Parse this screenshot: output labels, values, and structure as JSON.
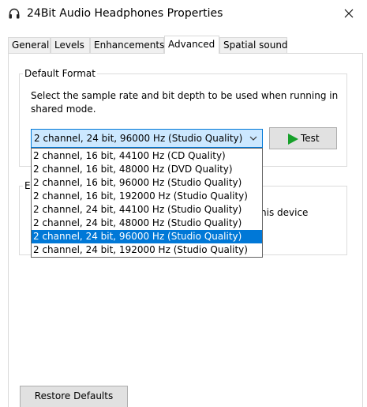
{
  "window": {
    "title": "24Bit Audio Headphones Properties",
    "app_icon": "headphones-icon",
    "close_icon": "close-icon"
  },
  "tabs": [
    {
      "label": "General"
    },
    {
      "label": "Levels"
    },
    {
      "label": "Enhancements"
    },
    {
      "label": "Advanced",
      "active": true
    },
    {
      "label": "Spatial sound"
    }
  ],
  "default_format": {
    "label": "Default Format",
    "description": "Select the sample rate and bit depth to be used when running in shared mode.",
    "selected_value": "2 channel, 24 bit, 96000 Hz (Studio Quality)",
    "test_label": "Test",
    "options": [
      "2 channel, 16 bit, 44100 Hz (CD Quality)",
      "2 channel, 16 bit, 48000 Hz (DVD Quality)",
      "2 channel, 16 bit, 96000 Hz (Studio Quality)",
      "2 channel, 16 bit, 192000 Hz (Studio Quality)",
      "2 channel, 24 bit, 44100 Hz (Studio Quality)",
      "2 channel, 24 bit, 48000 Hz (Studio Quality)",
      "2 channel, 24 bit, 96000 Hz (Studio Quality)",
      "2 channel, 24 bit, 192000 Hz (Studio Quality)"
    ],
    "selected_index": 6
  },
  "exclusive_mode": {
    "label_partial": "E",
    "text_partial": "his device"
  },
  "buttons": {
    "restore_defaults": "Restore Defaults"
  },
  "colors": {
    "accent": "#0078d7",
    "play_green": "#16a02a"
  }
}
